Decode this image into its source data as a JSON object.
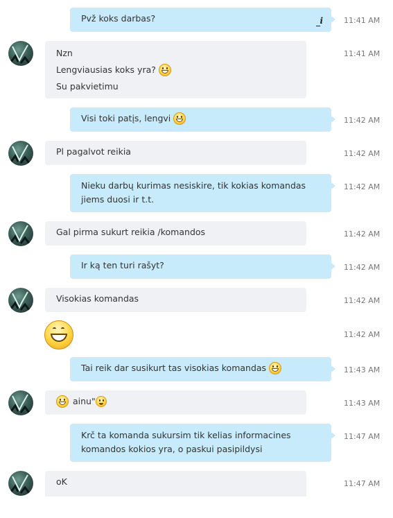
{
  "messages": [
    {
      "dir": "out",
      "lines": [
        "Pvž koks darbas?"
      ],
      "time": "11:41 AM",
      "edited": true
    },
    {
      "dir": "in",
      "lines": [
        "Nzn",
        "Lengviausias koks yra?",
        "Su pakvietimu"
      ],
      "time": "11:41 AM"
    },
    {
      "dir": "out",
      "lines": [
        "Visi toki patįs, lengvi"
      ],
      "time": "11:42 AM"
    },
    {
      "dir": "in",
      "lines": [
        "Pl pagalvot reikia"
      ],
      "time": "11:42 AM"
    },
    {
      "dir": "out",
      "lines": [
        "Nieku darbų kurimas nesiskire, tik kokias komandas",
        "jiems duosi ir t.t."
      ],
      "time": "11:42 AM"
    },
    {
      "dir": "in",
      "lines": [
        "Gal pirma sukurt reikia /komandos"
      ],
      "time": "11:42 AM"
    },
    {
      "dir": "out",
      "lines": [
        "Ir ką ten turi rašyt?"
      ],
      "time": "11:42 AM"
    },
    {
      "dir": "in",
      "lines": [
        "Visokias komandas"
      ],
      "time": "11:42 AM"
    },
    {
      "dir": "in",
      "emoji": "big-grin",
      "time": "11:42 AM"
    },
    {
      "dir": "out",
      "lines": [
        "Tai reik dar susikurt tas visokias komandas"
      ],
      "time": "11:43 AM"
    },
    {
      "dir": "in",
      "lines": [
        "ainu\""
      ],
      "time": "11:43 AM"
    },
    {
      "dir": "out",
      "lines": [
        "Krč ta komanda sukursim tik kelias informacines",
        "komandos kokios yra, o paskui pasipildysi"
      ],
      "time": "11:47 AM"
    },
    {
      "dir": "in",
      "lines": [
        "oK"
      ],
      "time": "11:47 AM"
    }
  ],
  "icons": {
    "edited": "edit-pencil-icon",
    "smiley": "grin-emoticon-icon",
    "smile": "smile-emoticon-icon",
    "avatar": "contact-avatar"
  },
  "colors": {
    "outgoing_bubble": "#c7ebfa",
    "incoming_bubble": "#f0f1f4",
    "timestamp": "#787878"
  }
}
